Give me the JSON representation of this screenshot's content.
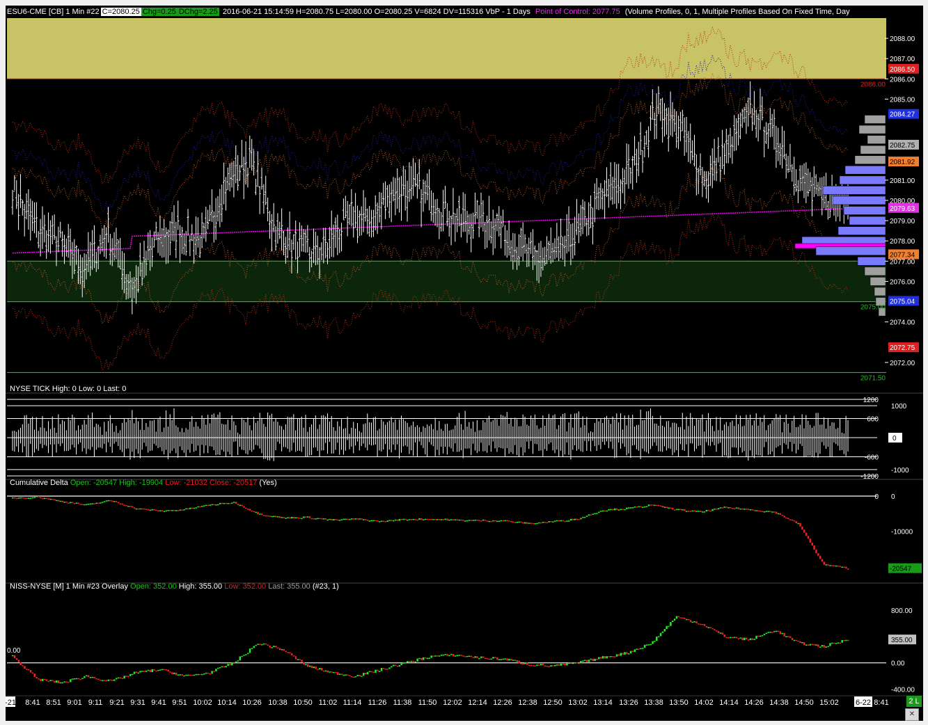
{
  "header": {
    "symbol": "ESU6-CME [CB]  1 Min  #22",
    "close": "C=2080.25",
    "chg": "Chg=0.25",
    "dchg": "DChg=2.25",
    "info": "2016-06-21 15:14:59 H=2080.75 L=2080.00 O=2080.25 V=6824 DV=115316  VbP - 1 Days",
    "poc": "Point of Control: 2077.75",
    "profile": "(Volume Profiles, 0, 1, Multiple Profiles Based On Fixed Time, Day"
  },
  "tick_panel": {
    "title": "NYSE TICK  High: 0  Low: 0  Last: 0"
  },
  "delta_panel": {
    "title": "Cumulative Delta",
    "open": "Open: -20547",
    "high": "High: -19904",
    "low": "Low: -21032",
    "close": "Close: -20517",
    "yes": "(Yes)"
  },
  "niss_panel": {
    "title": "NISS-NYSE [M]  1 Min  #23 Overlay",
    "open": "Open: 352.00",
    "high": "High: 355.00",
    "low": "Low: 352.00",
    "last": "Last: 355.00",
    "tag": "(#23, 1)",
    "zero_label": "0.00"
  },
  "price_axis": {
    "ticks": [
      "2088.00",
      "2087.00",
      "2086.00",
      "2085.00",
      "2081.00",
      "2080.00",
      "2079.00",
      "2078.00",
      "2077.00",
      "2076.00",
      "2074.00",
      "2072.00"
    ],
    "badges": [
      {
        "text": "2086.50",
        "bg": "#e02020",
        "fg": "#ffffff",
        "price": 2086.5
      },
      {
        "text": "2084.27",
        "bg": "#2030e0",
        "fg": "#ffffff",
        "price": 2084.27
      },
      {
        "text": "2082.75",
        "bg": "#b0b0b0",
        "fg": "#000000",
        "price": 2082.75
      },
      {
        "text": "2081.92",
        "bg": "#f08030",
        "fg": "#000000",
        "price": 2081.92
      },
      {
        "text": "2079.63",
        "bg": "#e030e0",
        "fg": "#ffffff",
        "price": 2079.63
      },
      {
        "text": "2077.34",
        "bg": "#f08030",
        "fg": "#000000",
        "price": 2077.34
      },
      {
        "text": "2075.04",
        "bg": "#2030e0",
        "fg": "#ffffff",
        "price": 2075.04
      },
      {
        "text": "2072.75",
        "bg": "#e02020",
        "fg": "#ffffff",
        "price": 2072.75
      }
    ],
    "level_labels": [
      {
        "text": "2086.00",
        "color": "#e02020",
        "price": 2086.0
      },
      {
        "text": "2075.00",
        "color": "#1fbf1f",
        "price": 2075.0
      },
      {
        "text": "2071.50",
        "color": "#1fbf1f",
        "price": 2071.5
      }
    ]
  },
  "tick_axis": {
    "ticks": [
      "1200",
      "1000",
      "600",
      "0",
      "-600",
      "-1000",
      "-1200"
    ],
    "last_badge": "0"
  },
  "delta_axis": {
    "ticks": [
      "0",
      "0",
      "-10000"
    ],
    "badge": "-20547"
  },
  "niss_axis": {
    "ticks": [
      "800.00",
      "0.00",
      "-400.00"
    ],
    "badge": "355.00"
  },
  "time_axis": {
    "labels": [
      "-21",
      "8:41",
      "8:51",
      "9:01",
      "9:11",
      "9:21",
      "9:31",
      "9:41",
      "9:51",
      "10:02",
      "10:14",
      "10:26",
      "10:38",
      "10:50",
      "11:02",
      "11:14",
      "11:26",
      "11:38",
      "11:50",
      "12:02",
      "12:14",
      "12:26",
      "12:38",
      "12:50",
      "13:02",
      "13:14",
      "13:26",
      "13:38",
      "13:50",
      "14:02",
      "14:14",
      "14:26",
      "14:38",
      "14:50",
      "15:02",
      "6-22",
      "8:41"
    ]
  },
  "status": {
    "badge": "2 L"
  },
  "colors": {
    "zone_yellow": "#c8c466",
    "zone_green": "#0c260c",
    "line_green": "#1fbf1f",
    "poc_magenta": "#ff00ff",
    "profile_blue": "#7a7aff",
    "profile_gray": "#a0a0a0",
    "up": "#22ee22",
    "down": "#ee2222"
  },
  "chart_data": [
    {
      "type": "line",
      "title": "ESU6-CME 1 Min price (approximate close path)",
      "ylim": [
        2071.0,
        2089.0
      ],
      "x": [
        "8:31",
        "8:41",
        "8:51",
        "9:01",
        "9:11",
        "9:21",
        "9:31",
        "9:41",
        "9:51",
        "10:02",
        "10:14",
        "10:26",
        "10:38",
        "10:50",
        "11:02",
        "11:14",
        "11:26",
        "11:38",
        "11:50",
        "12:02",
        "12:14",
        "12:26",
        "12:38",
        "12:50",
        "13:02",
        "13:14",
        "13:26",
        "13:38",
        "13:50",
        "14:02",
        "14:14",
        "14:26",
        "14:38",
        "14:50",
        "15:02",
        "15:14"
      ],
      "values": [
        2080.5,
        2078.5,
        2078.0,
        2076.5,
        2078.5,
        2075.5,
        2078.0,
        2078.5,
        2078.0,
        2081.0,
        2082.0,
        2078.5,
        2077.5,
        2077.5,
        2079.0,
        2079.0,
        2080.5,
        2080.5,
        2079.5,
        2079.0,
        2079.0,
        2078.0,
        2077.0,
        2077.5,
        2079.0,
        2080.5,
        2081.5,
        2084.5,
        2083.5,
        2081.0,
        2082.5,
        2084.5,
        2083.0,
        2081.0,
        2080.0,
        2080.25
      ],
      "zones": [
        {
          "from": 2086.0,
          "to": 2089.0,
          "color": "yellow"
        },
        {
          "from": 2075.0,
          "to": 2077.0,
          "color": "green"
        }
      ],
      "lines": [
        2086.0,
        2077.0,
        2075.0,
        2071.5
      ],
      "point_of_control": 2077.75,
      "volume_profile": [
        {
          "price": 2084.0,
          "w": 30,
          "c": "gray"
        },
        {
          "price": 2083.5,
          "w": 38,
          "c": "gray"
        },
        {
          "price": 2083.0,
          "w": 26,
          "c": "gray"
        },
        {
          "price": 2082.5,
          "w": 36,
          "c": "gray"
        },
        {
          "price": 2082.0,
          "w": 44,
          "c": "gray"
        },
        {
          "price": 2081.5,
          "w": 58,
          "c": "blue"
        },
        {
          "price": 2081.0,
          "w": 66,
          "c": "blue"
        },
        {
          "price": 2080.5,
          "w": 90,
          "c": "blue"
        },
        {
          "price": 2080.0,
          "w": 76,
          "c": "blue"
        },
        {
          "price": 2079.5,
          "w": 60,
          "c": "blue"
        },
        {
          "price": 2079.0,
          "w": 52,
          "c": "blue"
        },
        {
          "price": 2078.5,
          "w": 68,
          "c": "blue"
        },
        {
          "price": 2078.0,
          "w": 120,
          "c": "blue"
        },
        {
          "price": 2077.75,
          "w": 130,
          "c": "magenta"
        },
        {
          "price": 2077.5,
          "w": 100,
          "c": "blue"
        },
        {
          "price": 2077.0,
          "w": 40,
          "c": "blue"
        },
        {
          "price": 2076.5,
          "w": 30,
          "c": "gray"
        },
        {
          "price": 2076.0,
          "w": 22,
          "c": "gray"
        },
        {
          "price": 2075.5,
          "w": 16,
          "c": "gray"
        },
        {
          "price": 2075.0,
          "w": 14,
          "c": "gray"
        },
        {
          "price": 2074.5,
          "w": 10,
          "c": "gray"
        }
      ]
    },
    {
      "type": "bar",
      "title": "NYSE TICK",
      "ylim": [
        -1200,
        1200
      ],
      "values": [
        -300,
        400,
        -450,
        350,
        -500,
        600,
        -200,
        300,
        -700,
        500,
        -400,
        800,
        -300,
        450,
        -600,
        350,
        -200,
        500,
        -800,
        300,
        -350,
        450,
        -400,
        300,
        -250,
        400,
        -500,
        600,
        -300,
        350,
        -450,
        500,
        -600,
        400,
        -300,
        800,
        -400,
        350,
        -500,
        450,
        -650,
        300,
        -250,
        500,
        -700,
        850,
        -300,
        400,
        -500,
        450,
        -350,
        600,
        -750,
        900,
        -400,
        350,
        -600,
        500,
        -450,
        300
      ]
    },
    {
      "type": "line",
      "title": "Cumulative Delta",
      "ylim": [
        -24000,
        0
      ],
      "values": [
        -500,
        -200,
        -1500,
        -2500,
        -1200,
        -3500,
        -4200,
        -3800,
        -2500,
        -1800,
        -5000,
        -6200,
        -6000,
        -6800,
        -6500,
        -7200,
        -6600,
        -6500,
        -6800,
        -6900,
        -7000,
        -7800,
        -7200,
        -6500,
        -4000,
        -3500,
        -2500,
        -3800,
        -4500,
        -3200,
        -3800,
        -4500,
        -8000,
        -19500,
        -20500
      ]
    },
    {
      "type": "line",
      "title": "NISS-NYSE [M]",
      "ylim": [
        -500,
        1000
      ],
      "values": [
        100,
        -250,
        -300,
        -200,
        -280,
        -150,
        -100,
        -200,
        -150,
        0,
        300,
        200,
        -50,
        -150,
        -200,
        -100,
        0,
        100,
        120,
        80,
        60,
        -20,
        -50,
        0,
        80,
        150,
        300,
        700,
        600,
        400,
        350,
        500,
        300,
        250,
        355
      ]
    }
  ]
}
